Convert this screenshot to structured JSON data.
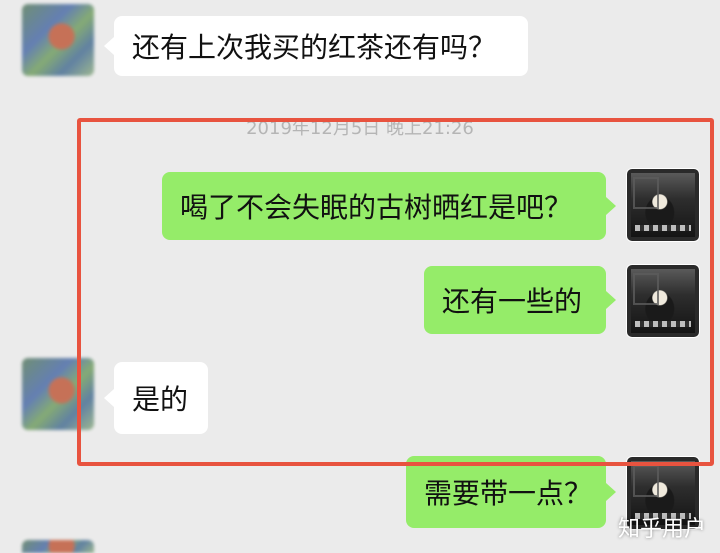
{
  "chat": {
    "timestamp": "2019年12月5日 晚上21:26",
    "messages": [
      {
        "side": "left",
        "text": "还有上次我买的红茶还有吗？"
      },
      {
        "side": "right",
        "text": "喝了不会失眠的古树晒红是吧？"
      },
      {
        "side": "right",
        "text": "还有一些的"
      },
      {
        "side": "left",
        "text": "是的"
      },
      {
        "side": "right",
        "text": "需要带一点？"
      }
    ]
  },
  "watermark": "知乎用户",
  "colors": {
    "background": "#ebebeb",
    "incoming_bubble": "#ffffff",
    "outgoing_bubble": "#95ec69",
    "highlight_border": "#e8533f",
    "timestamp_text": "#b5b5b5"
  }
}
